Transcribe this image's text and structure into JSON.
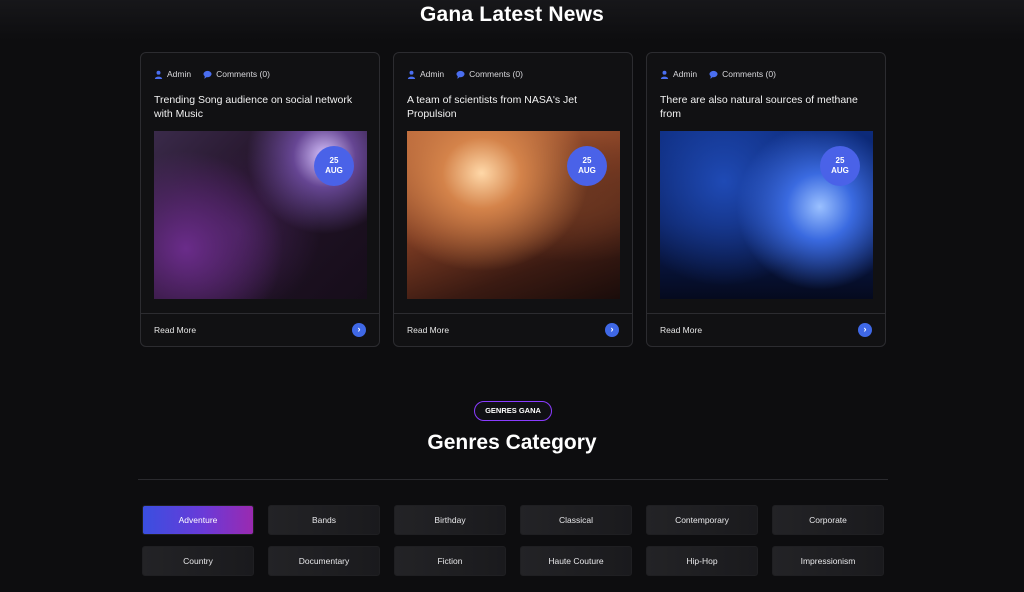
{
  "news": {
    "title": "Gana Latest News",
    "cards": [
      {
        "author": "Admin",
        "comments": "Comments (0)",
        "title": "Trending Song audience on social network with Music",
        "day": "25",
        "month": "AUG",
        "read_more": "Read More"
      },
      {
        "author": "Admin",
        "comments": "Comments (0)",
        "title": "A team of scientists from NASA's Jet Propulsion",
        "day": "25",
        "month": "AUG",
        "read_more": "Read More"
      },
      {
        "author": "Admin",
        "comments": "Comments (0)",
        "title": "There are also natural sources of methane from",
        "day": "25",
        "month": "AUG",
        "read_more": "Read More"
      }
    ]
  },
  "genres": {
    "tag": "GENRES GANA",
    "title": "Genres Category",
    "items": [
      "Adventure",
      "Bands",
      "Birthday",
      "Classical",
      "Contemporary",
      "Corporate",
      "Country",
      "Documentary",
      "Fiction",
      "Haute Couture",
      "Hip-Hop",
      "Impressionism"
    ],
    "active": "Adventure"
  },
  "colors": {
    "accent": "#3f68e6",
    "tag_border": "#8a3cff",
    "background": "#0d0d0f"
  }
}
